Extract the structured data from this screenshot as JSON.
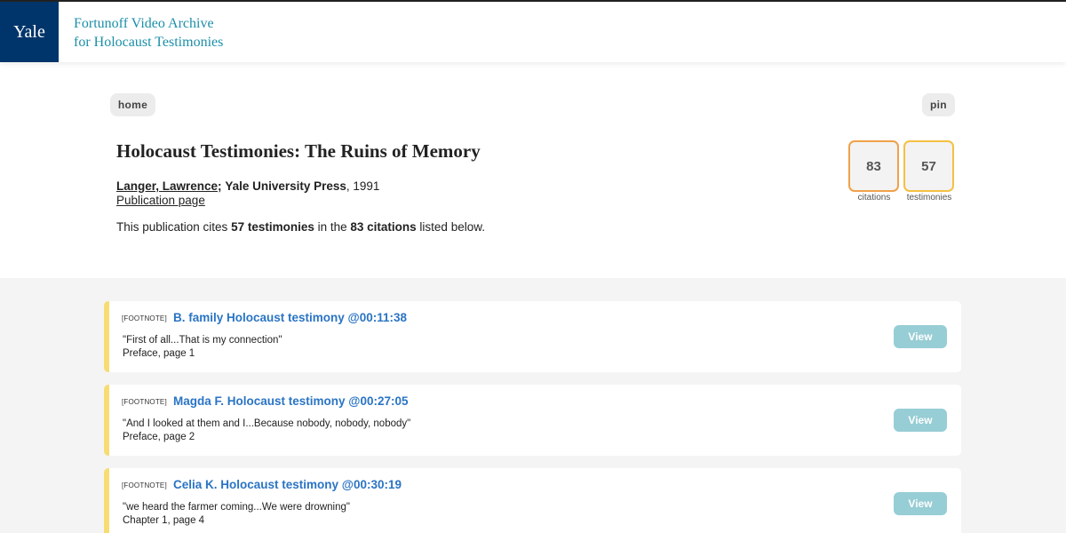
{
  "header": {
    "logo_text": "Yale",
    "archive_line1": "Fortunoff Video Archive",
    "archive_line2": "for Holocaust Testimonies"
  },
  "nav": {
    "home_label": "home",
    "pin_label": "pin"
  },
  "publication": {
    "title": "Holocaust Testimonies: The Ruins of Memory",
    "author": "Langer, Lawrence",
    "separator": ";",
    "publisher": "Yale University Press",
    "year": ", 1991",
    "link_label": "Publication page",
    "summary_prefix": "This publication cites ",
    "summary_testimonies": "57 testimonies",
    "summary_mid": " in the ",
    "summary_citations": "83 citations",
    "summary_suffix": " listed below."
  },
  "stats": {
    "citations_count": "83",
    "citations_label": "citations",
    "testimonies_count": "57",
    "testimonies_label": "testimonies",
    "citations_color": "#f0a14a",
    "testimonies_color": "#f5c044"
  },
  "citations": [
    {
      "tag": "[FOOTNOTE]",
      "title": "B. family Holocaust testimony @00:11:38",
      "quote": "\"First of all...That is my connection\"",
      "location": "Preface, page 1",
      "view_label": "View"
    },
    {
      "tag": "[FOOTNOTE]",
      "title": "Magda F. Holocaust testimony @00:27:05",
      "quote": "\"And I looked at them and I...Because nobody, nobody, nobody\"",
      "location": "Preface, page 2",
      "view_label": "View"
    },
    {
      "tag": "[FOOTNOTE]",
      "title": "Celia K. Holocaust testimony @00:30:19",
      "quote": "\"we heard the farmer coming...We were drowning\"",
      "location": "Chapter 1, page 4",
      "view_label": "View"
    }
  ],
  "colors": {
    "yale_blue": "#00356b",
    "archive_teal": "#1a8fa8",
    "link_blue": "#2a74c4",
    "view_button": "#97cdd5",
    "card_accent": "#f7dc74"
  }
}
